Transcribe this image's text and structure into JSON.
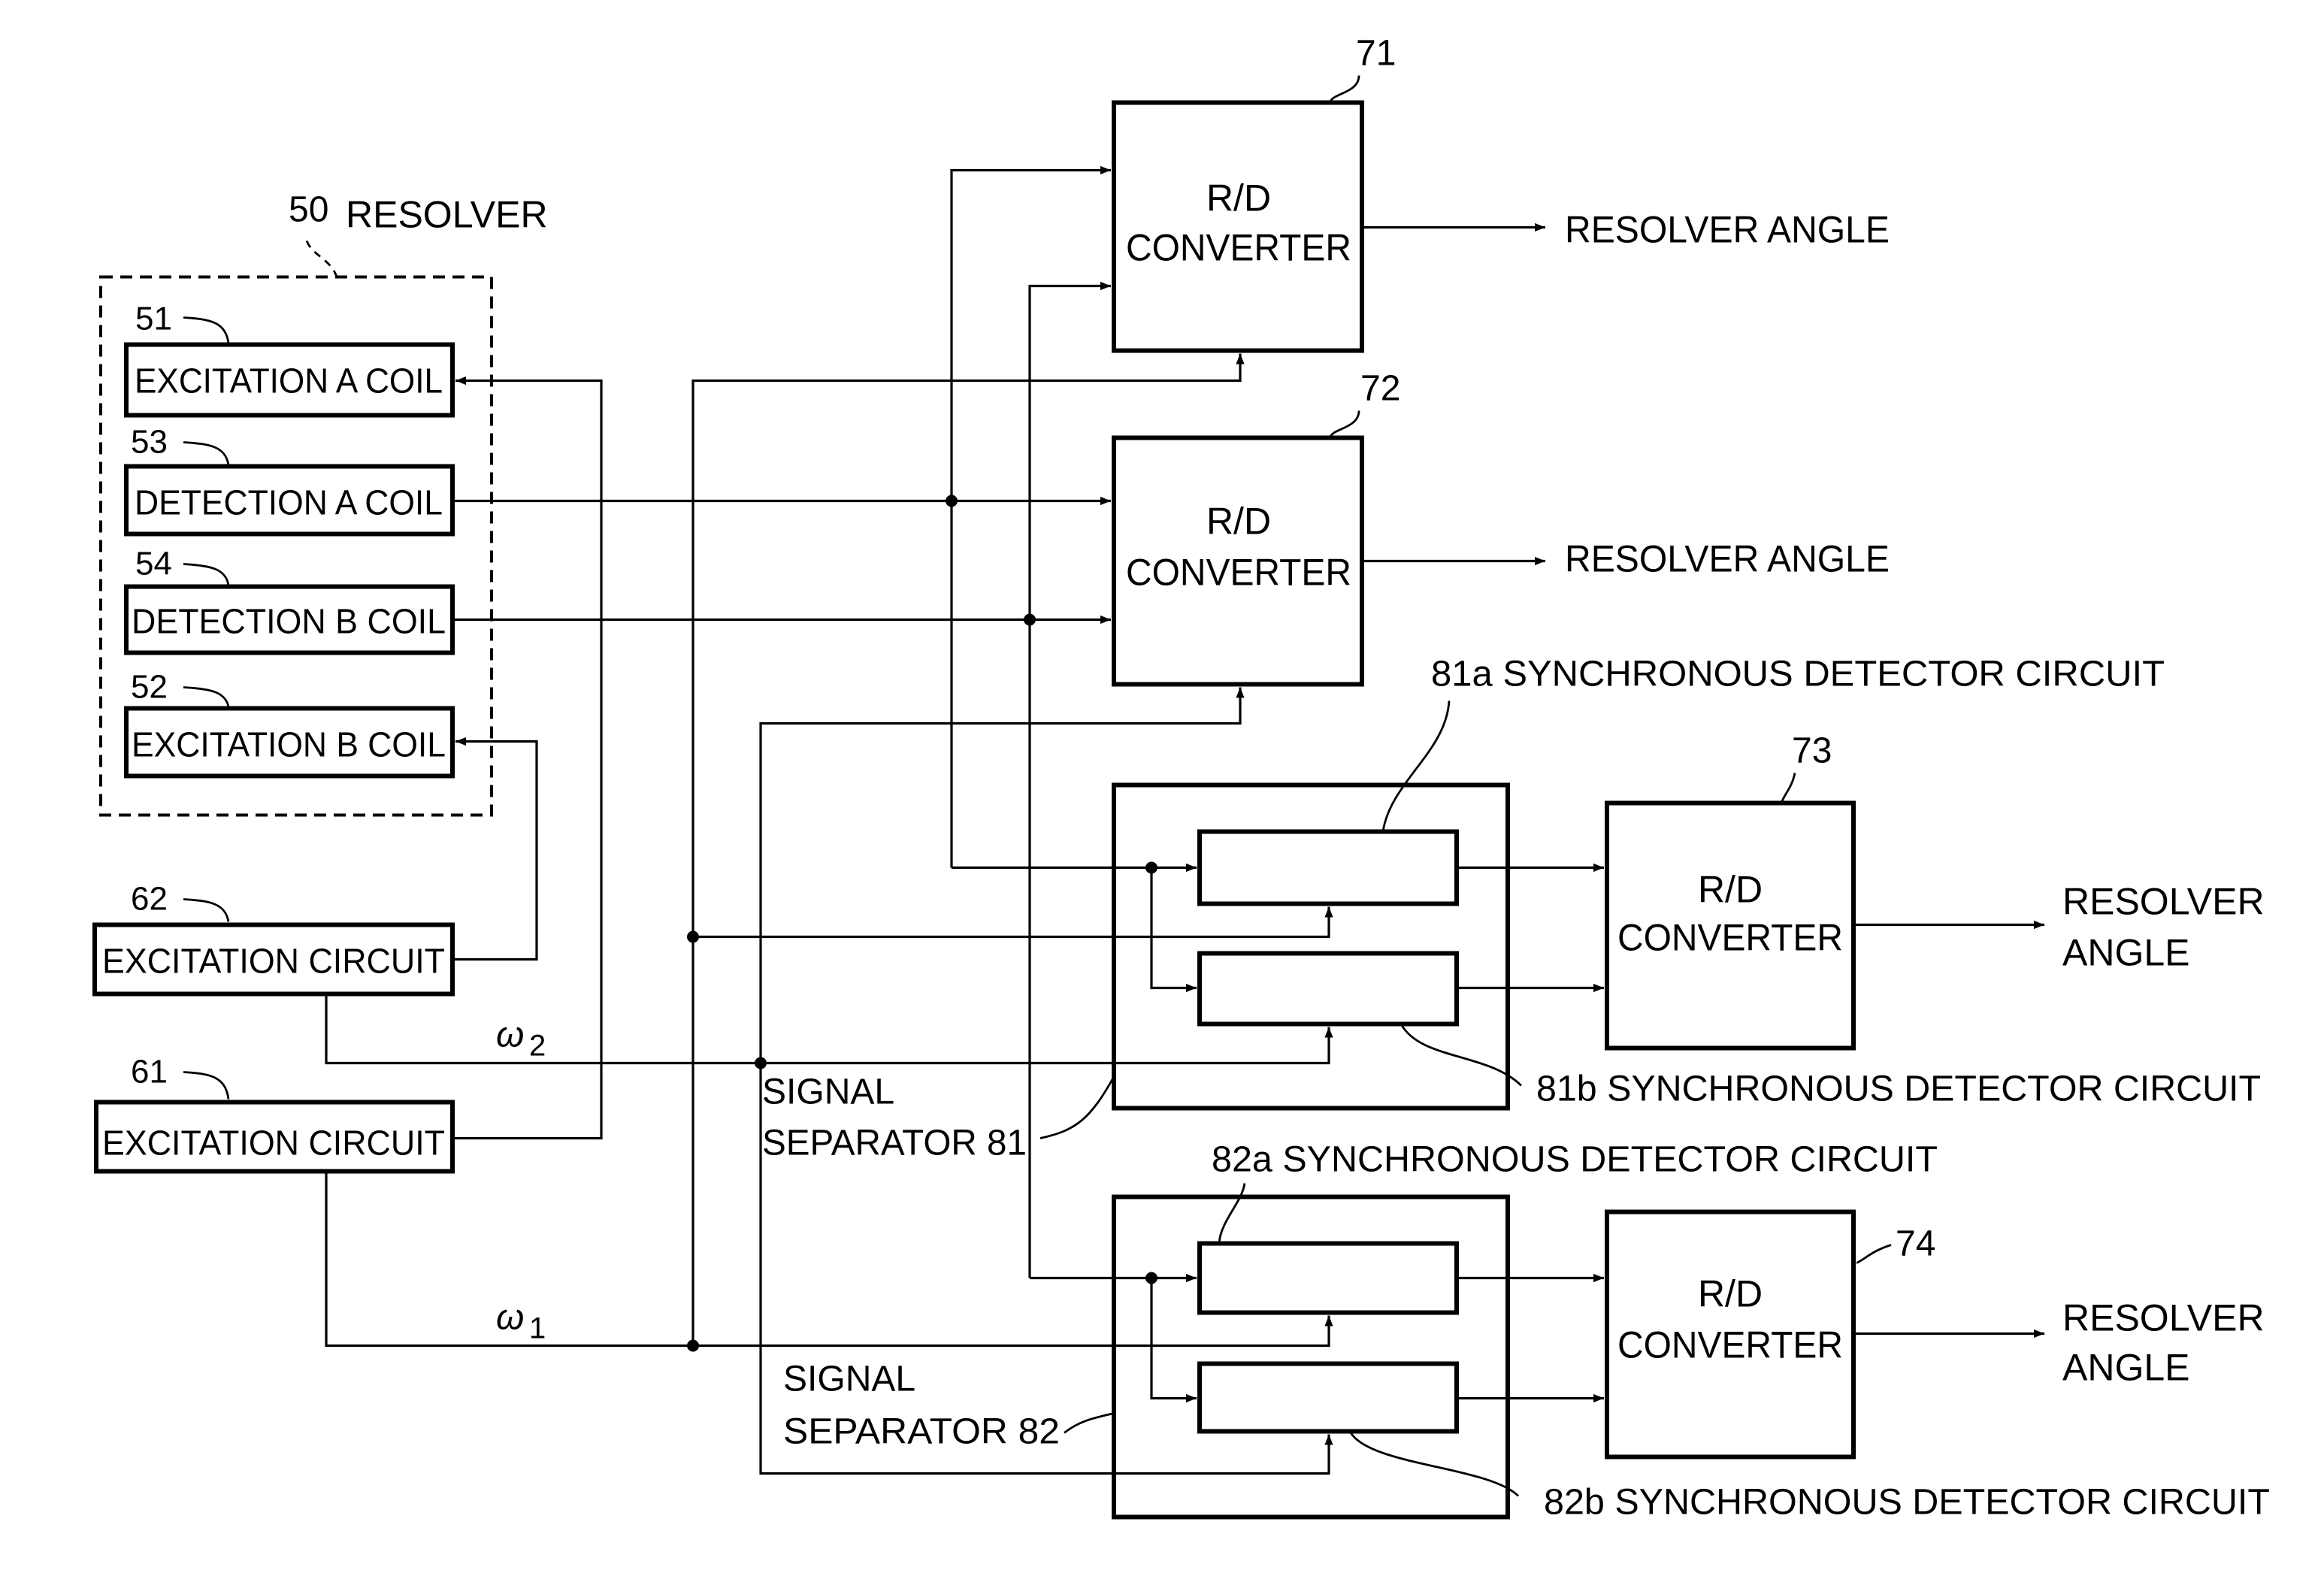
{
  "resolver": {
    "ref": "50",
    "label": "RESOLVER"
  },
  "coils": [
    {
      "ref": "51",
      "label": "EXCITATION A COIL"
    },
    {
      "ref": "53",
      "label": "DETECTION A COIL"
    },
    {
      "ref": "54",
      "label": "DETECTION B COIL"
    },
    {
      "ref": "52",
      "label": "EXCITATION B COIL"
    }
  ],
  "excitation_circuits": [
    {
      "ref": "62",
      "label": "EXCITATION CIRCUIT",
      "signal": "ω",
      "subscript": "2"
    },
    {
      "ref": "61",
      "label": "EXCITATION CIRCUIT",
      "signal": "ω",
      "subscript": "1"
    }
  ],
  "converters": [
    {
      "ref": "71",
      "line1": "R/D",
      "line2": "CONVERTER",
      "output1": "RESOLVER ANGLE",
      "output2": ""
    },
    {
      "ref": "72",
      "line1": "R/D",
      "line2": "CONVERTER",
      "output1": "RESOLVER ANGLE",
      "output2": ""
    },
    {
      "ref": "73",
      "line1": "R/D",
      "line2": "CONVERTER",
      "output1": "RESOLVER",
      "output2": "ANGLE"
    },
    {
      "ref": "74",
      "line1": "R/D",
      "line2": "CONVERTER",
      "output1": "RESOLVER",
      "output2": "ANGLE"
    }
  ],
  "separators": [
    {
      "line1": "SIGNAL",
      "line2": "SEPARATOR 81"
    },
    {
      "line1": "SIGNAL",
      "line2": "SEPARATOR 82"
    }
  ],
  "detectors": [
    {
      "label": "81a  SYNCHRONOUS DETECTOR CIRCUIT"
    },
    {
      "label": "81b SYNCHRONOUS DETECTOR CIRCUIT"
    },
    {
      "label": "82a SYNCHRONOUS DETECTOR CIRCUIT"
    },
    {
      "label": "82b SYNCHRONOUS DETECTOR CIRCUIT"
    }
  ]
}
